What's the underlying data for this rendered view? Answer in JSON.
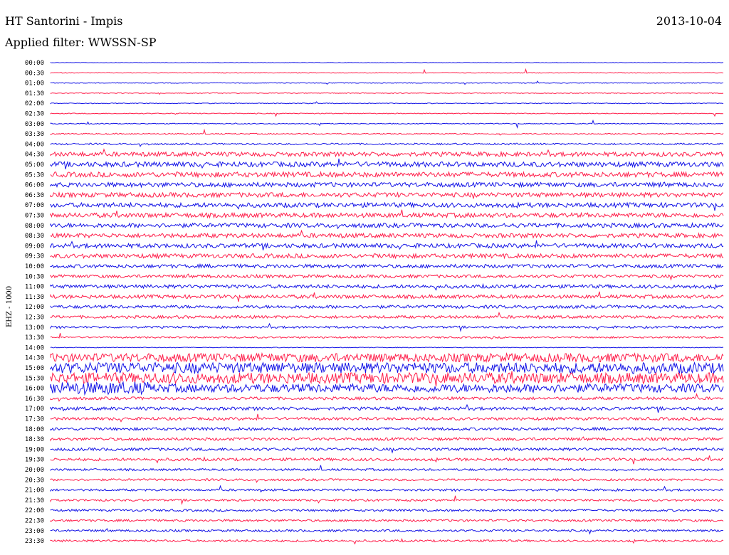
{
  "header": {
    "station": "HT Santorini - Impis",
    "date": "2013-10-04",
    "filter": "Applied filter: WWSSN-SP",
    "channel": "EHZ - 1000"
  },
  "colors": {
    "even": "#1414e6",
    "odd": "#ff1f4b"
  },
  "chart_data": {
    "type": "line",
    "title": "HT Santorini - Impis",
    "ylabel": "EHZ - 1000",
    "time_labels": [
      "00:00",
      "00:30",
      "01:00",
      "01:30",
      "02:00",
      "02:30",
      "03:00",
      "03:30",
      "04:00",
      "04:30",
      "05:00",
      "05:30",
      "06:00",
      "06:30",
      "07:00",
      "07:30",
      "08:00",
      "08:30",
      "09:00",
      "09:30",
      "10:00",
      "10:30",
      "11:00",
      "11:30",
      "12:00",
      "12:30",
      "13:00",
      "13:30",
      "14:00",
      "14:30",
      "15:00",
      "15:30",
      "16:00",
      "16:30",
      "17:00",
      "17:30",
      "18:00",
      "18:30",
      "19:00",
      "19:30",
      "20:00",
      "20:30",
      "21:00",
      "21:30",
      "22:00",
      "22:30",
      "23:00",
      "23:30"
    ],
    "trace_amplitude": [
      0.3,
      0.5,
      0.5,
      0.5,
      0.5,
      0.6,
      0.6,
      0.8,
      1.2,
      3.0,
      3.5,
      3.5,
      3.2,
      3.2,
      3.2,
      3.2,
      3.0,
      3.0,
      3.0,
      3.0,
      2.5,
      2.2,
      2.5,
      2.5,
      2.2,
      2.0,
      1.5,
      1.2,
      0.5,
      6.0,
      7.5,
      7.5,
      6.0,
      2.0,
      2.2,
      2.0,
      2.0,
      2.0,
      2.0,
      2.0,
      1.5,
      1.5,
      1.5,
      1.5,
      1.5,
      1.5,
      1.5,
      1.5
    ],
    "x_range": [
      0,
      30
    ],
    "xlabel": ""
  }
}
